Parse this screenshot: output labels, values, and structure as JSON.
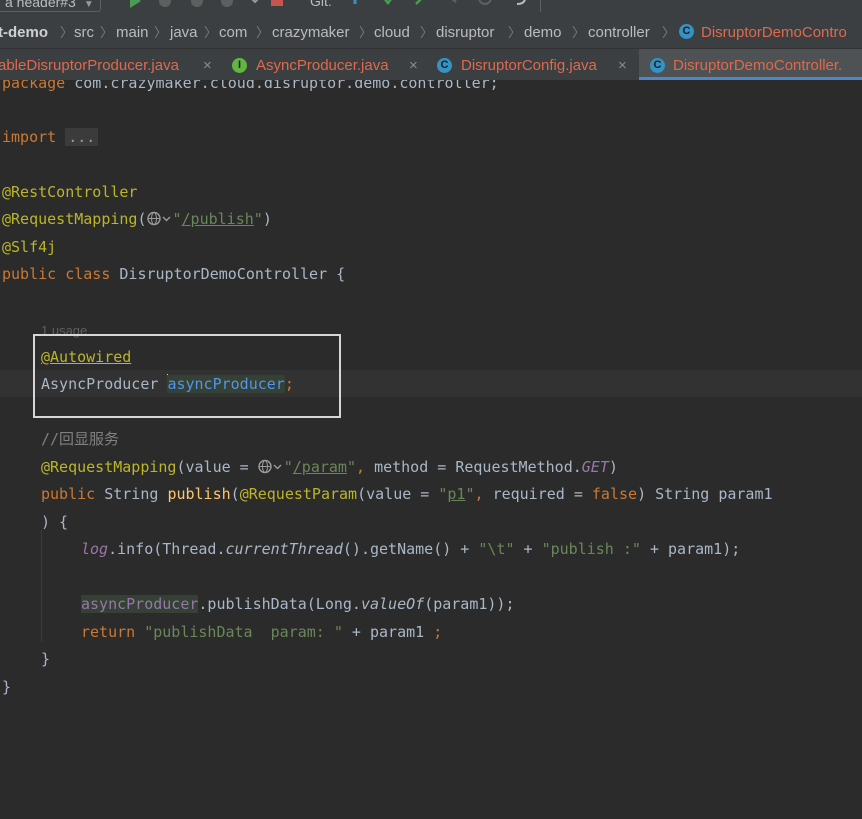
{
  "toolbar": {
    "run_config": "a header#3",
    "git_label": "Git:"
  },
  "breadcrumb": {
    "items": [
      "t-demo",
      "src",
      "main",
      "java",
      "com",
      "crazymaker",
      "cloud",
      "disruptor",
      "demo",
      "controller",
      "DisruptorDemoContro"
    ]
  },
  "tabs": [
    {
      "label": "ableDisruptorProducer.java",
      "icon": "none"
    },
    {
      "label": "AsyncProducer.java",
      "icon": "interface-icon"
    },
    {
      "label": "DisruptorConfig.java",
      "icon": "class-icon"
    },
    {
      "label": "DisruptorDemoController.",
      "icon": "class-icon"
    }
  ],
  "colors": {
    "editor_bg": "#2b2b2b",
    "keyword": "#cc7832",
    "annotation": "#bbb529",
    "string": "#6a8759",
    "field": "#9876aa",
    "tab_text": "#e0694c"
  },
  "code": {
    "package_line": "package com.crazymaker.cloud.disruptor.demo.controller;",
    "import_kw": "import",
    "import_fold": "...",
    "ann_rest": "@RestController",
    "ann_reqmap": "@RequestMapping",
    "reqmap_path": "/publish",
    "ann_slf4j": "@Slf4j",
    "class_kw": "public class",
    "class_name": "DisruptorDemoController",
    "open_brace": "{",
    "usage_hint": "1 usage",
    "ann_autowired": "@Autowired",
    "field_type": "AsyncProducer",
    "field_name": "asyncProducer",
    "comment": "//回显服务",
    "method_ann": "@RequestMapping",
    "method_ann_value_key": "value = ",
    "method_ann_path": "/param",
    "method_ann_method": "method = RequestMethod.",
    "method_ann_get": "GET",
    "method_sig_kw": "public",
    "method_sig_type": "String",
    "method_name": "publish",
    "param_ann": "@RequestParam",
    "param_value_key": "value = ",
    "param_value": "p1",
    "param_required": "required = ",
    "param_false": "false",
    "param_rest": ") String param1",
    "close_paren_brace": ") {",
    "log_field": "log",
    "log_call": ".info(Thread.",
    "current_thread": "currentThread",
    "get_name": "().getName() + ",
    "tab_str": "\"\\t\"",
    "plus": " + ",
    "publish_str": "\"publish :\"",
    "plus_param": " + param1);",
    "async_field": "asyncProducer",
    "publish_data_call": ".publishData(Long.",
    "value_of": "valueOf",
    "publish_data_end": "(param1));",
    "return_kw": "return",
    "return_str": "\"publishData  param: \"",
    "return_rest": " + param1 ",
    "semicolon": ";",
    "close_method": "}",
    "close_class": "}"
  }
}
